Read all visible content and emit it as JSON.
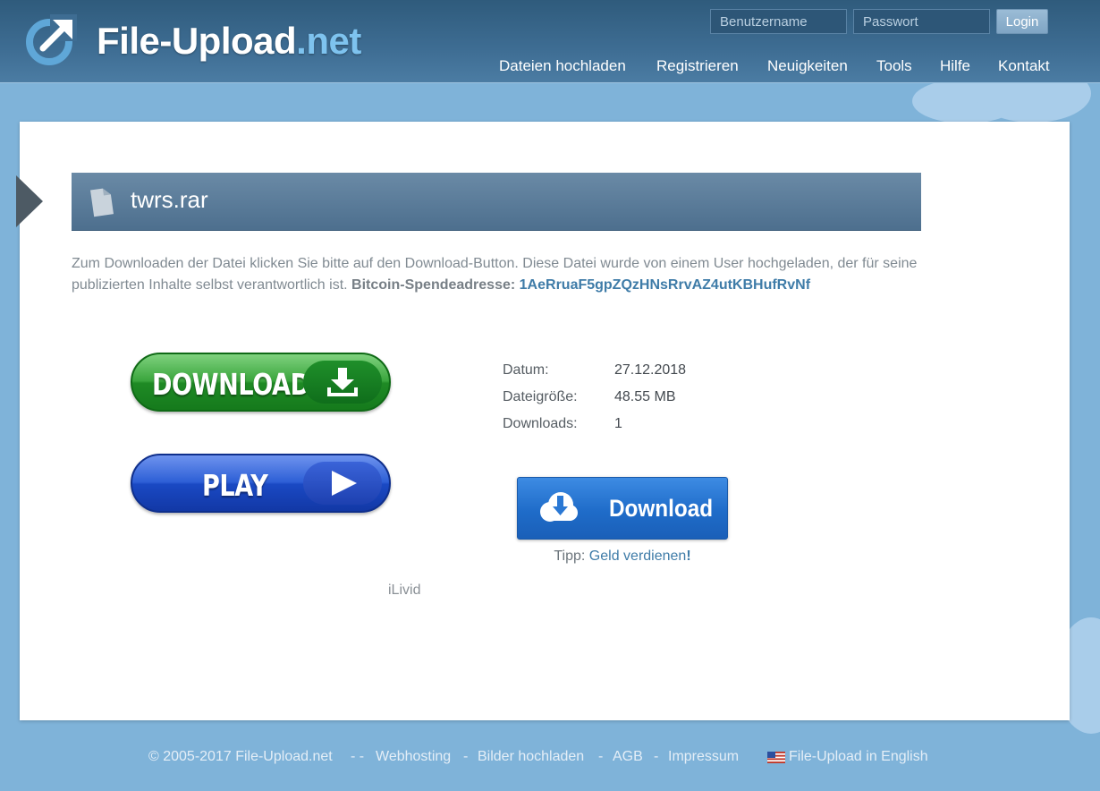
{
  "header": {
    "logo_main": "File-Upload",
    "logo_tld": ".net",
    "login": {
      "username_placeholder": "Benutzername",
      "password_placeholder": "Passwort",
      "button_label": "Login"
    },
    "nav": [
      "Dateien hochladen",
      "Registrieren",
      "Neuigkeiten",
      "Tools",
      "Hilfe",
      "Kontakt"
    ]
  },
  "file": {
    "name": "twrs.rar",
    "description": "Zum Downloaden der Datei klicken Sie bitte auf den Download-Button. Diese Datei wurde von einem User hochgeladen, der für seine publizierten Inhalte selbst verantwortlich ist.",
    "bitcoin_label": "Bitcoin-Spendeadresse:",
    "bitcoin_address": "1AeRruaF5gpZQzHNsRrvAZ4utKBHufRvNf"
  },
  "ads": {
    "download_label": "DOWNLOAD",
    "play_label": "PLAY",
    "ilivid_text": "iLivid"
  },
  "info": {
    "rows": [
      {
        "key": "Datum:",
        "value": "27.12.2018"
      },
      {
        "key": "Dateigröße:",
        "value": "48.55 MB"
      },
      {
        "key": "Downloads:",
        "value": "1"
      }
    ]
  },
  "download_button": {
    "label": "Download",
    "tip_prefix": "Tipp:",
    "tip_link": "Geld verdienen",
    "tip_suffix": "!"
  },
  "footer": {
    "copyright": "© 2005-2017 File-Upload.net",
    "sep1": "- -",
    "webhosting": "Webhosting",
    "sep2": "-",
    "bilder": "Bilder hochladen",
    "sep3": "-",
    "agb": "AGB",
    "sep4": "-",
    "impressum": "Impressum",
    "english": "File-Upload in English"
  },
  "colors": {
    "background": "#7fb3d9",
    "header": "#3e6d93",
    "link": "#3f7ca8",
    "download_green": "#1f8a25",
    "play_blue": "#1a49c3",
    "download_blue": "#1f6cc9"
  }
}
